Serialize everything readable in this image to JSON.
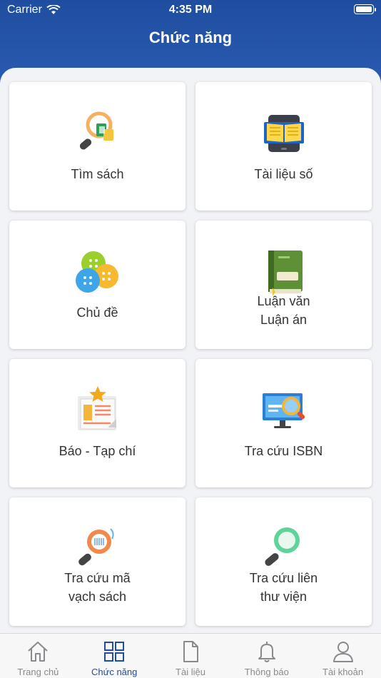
{
  "status": {
    "carrier": "Carrier",
    "time": "4:35 PM"
  },
  "header": {
    "title": "Chức năng"
  },
  "cards": [
    {
      "label": "Tìm sách",
      "label2": "",
      "icon": "book-search-icon"
    },
    {
      "label": "Tài liệu số",
      "label2": "",
      "icon": "ebook-tablet-icon"
    },
    {
      "label": "Chủ đề",
      "label2": "",
      "icon": "topic-buttons-icon"
    },
    {
      "label": "Luận văn",
      "label2": "Luận án",
      "icon": "thesis-book-icon"
    },
    {
      "label": "Báo - Tạp chí",
      "label2": "",
      "icon": "newspaper-icon"
    },
    {
      "label": "Tra cứu ISBN",
      "label2": "",
      "icon": "isbn-search-icon"
    },
    {
      "label": "Tra cứu mã",
      "label2": "vạch sách",
      "icon": "barcode-search-icon"
    },
    {
      "label": "Tra cứu liên",
      "label2": "thư viện",
      "icon": "library-search-icon"
    }
  ],
  "tabs": [
    {
      "label": "Trang chủ",
      "icon": "home-icon",
      "active": false
    },
    {
      "label": "Chức năng",
      "icon": "grid-icon",
      "active": true
    },
    {
      "label": "Tài liệu",
      "icon": "document-icon",
      "active": false
    },
    {
      "label": "Thông báo",
      "icon": "bell-icon",
      "active": false
    },
    {
      "label": "Tài khoản",
      "icon": "user-icon",
      "active": false
    }
  ],
  "colors": {
    "primary": "#1f4ea0",
    "inactive": "#8a8a8e"
  }
}
